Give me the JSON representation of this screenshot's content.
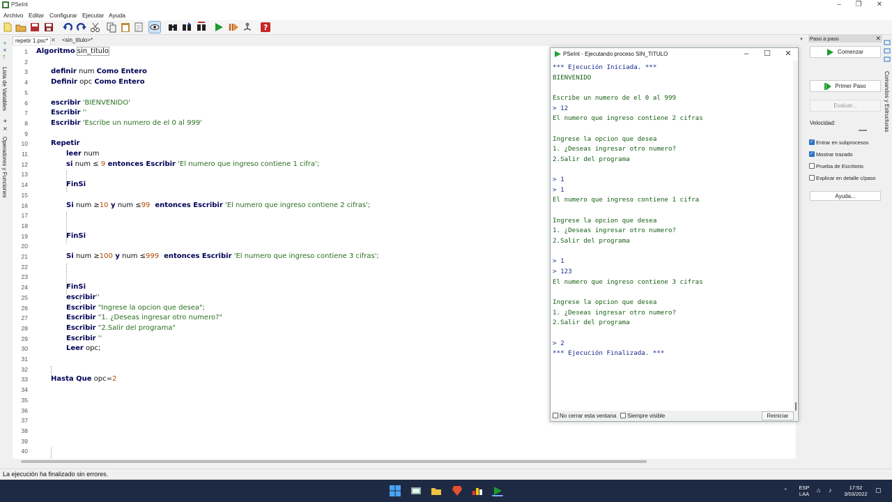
{
  "window": {
    "title": "PSeInt"
  },
  "menu": [
    "Archivo",
    "Editar",
    "Configurar",
    "Ejecutar",
    "Ayuda"
  ],
  "toolbar_icons": [
    "new-file-icon",
    "open-file-icon",
    "save-icon",
    "save-as-icon",
    "undo-icon",
    "redo-icon",
    "cut-icon",
    "copy-icon",
    "paste-icon",
    "edit-icon",
    "find-icon",
    "debug-eye-icon",
    "search-icon",
    "replace-icon",
    "format-icon",
    "run-icon",
    "step-icon",
    "draw-diagram-icon",
    "help-icon"
  ],
  "left_strip": {
    "variables": "Lista de Variables",
    "operators": "Operadores y Funciones"
  },
  "editor": {
    "tabs": [
      {
        "label": "repetir 1.psc*",
        "close": "✕"
      },
      {
        "label": "<sin_titulo>*"
      }
    ],
    "line_numbers": [
      "1",
      "2",
      "3",
      "4",
      "5",
      "6",
      "7",
      "8",
      "9",
      "10",
      "11",
      "12",
      "13",
      "14",
      "15",
      "16",
      "17",
      "18",
      "19",
      "20",
      "21",
      "22",
      "23",
      "24",
      "25",
      "26",
      "27",
      "28",
      "29",
      "30",
      "31",
      "32",
      "33",
      "34",
      "35",
      "36",
      "37",
      "38",
      "39",
      "40"
    ],
    "code": {
      "l1_kw": "Algoritmo",
      "l1_name": "sin_titulo",
      "l3_kw": "definir",
      "l3_var": " num ",
      "l3_kw2": "Como Entero",
      "l4_kw": "Definir",
      "l4_var": " opc ",
      "l4_kw2": "Como Entero",
      "l6_kw": "escribir",
      "l6_str": " 'BIENVENIDO'",
      "l7_kw": "Escribir",
      "l7_str": " ''",
      "l8_kw": "Escribir",
      "l8_str": " 'Escribe un numero de el 0 al 999'",
      "l10_kw": "Repetir",
      "l11_kw": "leer",
      "l11_var": " num",
      "l12_kw": "si",
      "l12_cond": " num ≤ ",
      "l12_num": "9",
      "l12_kw2": " entonces Escribir",
      "l12_str": " 'El numero que ingreso contiene 1 cifra';",
      "l14_kw": "FinSi",
      "l16_kw": "Si",
      "l16_a": " num ≥",
      "l16_n1": "10",
      "l16_kw2": " y",
      "l16_b": " num ≤",
      "l16_n2": "99",
      "l16_kw3": "  entonces Escribir",
      "l16_str": " 'El numero que ingreso contiene 2 cifras';",
      "l19_kw": "FinSi",
      "l21_kw": "Si",
      "l21_a": " num ≥",
      "l21_n1": "100",
      "l21_kw2": " y",
      "l21_b": " num ≤",
      "l21_n2": "999",
      "l21_kw3": "  entonces Escribir",
      "l21_str": " 'El numero que ingreso contiene 3 cifras';",
      "l24_kw": "FinSi",
      "l25_kw": "escribir",
      "l25_str": "''",
      "l26_kw": "Escribir",
      "l26_str": " \"Ingrese la opcion que desea\";",
      "l27_kw": "Escribir",
      "l27_str": " \"1. ¿Deseas ingresar otro numero?\"",
      "l28_kw": "Escribir",
      "l28_str": " \"2.Salir del programa\"",
      "l29_kw": "Escribir",
      "l29_str": " ''",
      "l30_kw": "Leer",
      "l30_var": " opc;",
      "l33_kw": "Hasta Que",
      "l33_var": " opc=",
      "l33_num": "2"
    }
  },
  "exec_window": {
    "title": "PSeInt - Ejecutando proceso SIN_TITULO",
    "console": [
      "*** Ejecución Iniciada. ***",
      "BIENVENIDO",
      "",
      "Escribe un numero de el 0 al 999",
      "> 12",
      "El numero que ingreso contiene 2 cifras",
      "",
      "Ingrese la opcion que desea",
      "1. ¿Deseas ingresar otro numero?",
      "2.Salir del programa",
      "",
      "> 1",
      "> 1",
      "El numero que ingreso contiene 1 cifra",
      "",
      "Ingrese la opcion que desea",
      "1. ¿Deseas ingresar otro numero?",
      "2.Salir del programa",
      "",
      "> 1",
      "> 123",
      "El numero que ingreso contiene 3 cifras",
      "",
      "Ingrese la opcion que desea",
      "1. ¿Deseas ingresar otro numero?",
      "2.Salir del programa",
      "",
      "> 2",
      "*** Ejecución Finalizada. ***"
    ],
    "no_close_label": "No cerrar esta ventana",
    "always_visible_label": "Siempre visible",
    "restart_label": "Reiniciar"
  },
  "step_panel": {
    "title": "Paso a paso",
    "start_label": "Comenzar",
    "first_step_label": "Primer Paso",
    "evaluate_label": "Evaluar...",
    "speed_label": "Velocidad:",
    "options": [
      {
        "label": "Entrar en subprocesos",
        "checked": true
      },
      {
        "label": "Mostrar trazado",
        "checked": true
      },
      {
        "label": "Prueba de Escritorio",
        "checked": false
      },
      {
        "label": "Explicar en detalle c/paso",
        "checked": false
      }
    ],
    "help_label": "Ayuda...",
    "side_label": "Comandos y Estructuras"
  },
  "status": {
    "text": "La ejecución ha finalizado sin errores."
  },
  "taskbar": {
    "lang1": "ESP",
    "lang2": "LAA",
    "time": "17:52",
    "date": "3/03/2022"
  }
}
